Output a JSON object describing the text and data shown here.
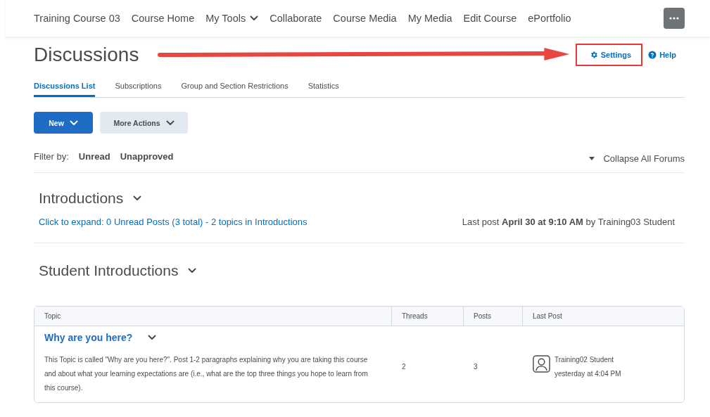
{
  "nav": {
    "items": [
      {
        "label": "Training Course 03",
        "kind": "link"
      },
      {
        "label": "Course Home",
        "kind": "link"
      },
      {
        "label": "My Tools",
        "kind": "menu"
      },
      {
        "label": "Collaborate",
        "kind": "link"
      },
      {
        "label": "Course Media",
        "kind": "link"
      },
      {
        "label": "My Media",
        "kind": "link"
      },
      {
        "label": "Edit Course",
        "kind": "link"
      },
      {
        "label": "ePortfolio",
        "kind": "link"
      }
    ]
  },
  "page": {
    "title": "Discussions",
    "settings": "Settings",
    "help": "Help"
  },
  "tabs": [
    {
      "label": "Discussions List",
      "selected": true
    },
    {
      "label": "Subscriptions",
      "selected": false
    },
    {
      "label": "Group and Section Restrictions",
      "selected": false
    },
    {
      "label": "Statistics",
      "selected": false
    }
  ],
  "buttons": [
    {
      "label": "New",
      "kind": "primary"
    },
    {
      "label": "More Actions",
      "kind": "secondary"
    }
  ],
  "filter": {
    "label": "Filter by:",
    "options": [
      "Unread",
      "Unapproved"
    ],
    "collapse": "Collapse All Forums"
  },
  "forums": [
    {
      "title": "Introductions",
      "summary_link": "Click to expand: 0 Unread Posts (3 total) - 2 topics in Introductions",
      "last_post": "Last post **April 30 at 9:10 AM** by Training03 Student"
    },
    {
      "title": "Student Introductions"
    }
  ],
  "table": {
    "columns": [
      "Topic",
      "Threads",
      "Posts",
      "Last Post"
    ],
    "rows": [
      {
        "topic": "Why are you here?",
        "description": "This Topic is called \"Why are you here?\".  Post 1-2 paragraphs explaining why you are taking this course and about what your learning expectations are (i.e., what are the top three things you hope to learn from this course).",
        "threads": "2",
        "posts": "3",
        "last_post_author": "Training02 Student",
        "last_post_time": "yesterday at 4:04 PM"
      }
    ]
  }
}
